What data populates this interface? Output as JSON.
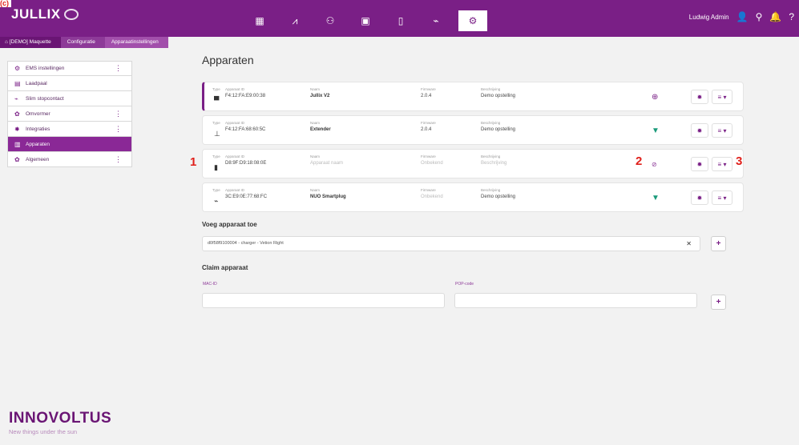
{
  "corner_badge": "(c)",
  "app": {
    "logo_text": "JULLIX"
  },
  "nav": {
    "icons": [
      "dashboard-icon",
      "chart-icon",
      "brain-icon",
      "battery-icon",
      "meter-icon",
      "plug-icon",
      "settings-icon"
    ],
    "glyphs": [
      "▦",
      "⩘",
      "⚇",
      "▣",
      "▯",
      "⌁",
      "⚙"
    ],
    "active": "settings-icon"
  },
  "user": {
    "name": "Ludwig Admin",
    "glyphs": {
      "person": "👤",
      "search": "⚲",
      "bell": "🔔",
      "help": "?"
    }
  },
  "breadcrumb": [
    "[DEMO] Maquette",
    "Configuratie",
    "Apparaatinstellingen"
  ],
  "sidebar": {
    "items": [
      {
        "label": "EMS instellingen",
        "glyph": "⚙",
        "kebab": "⋮"
      },
      {
        "label": "Laadpaal",
        "glyph": "▤",
        "kebab": ""
      },
      {
        "label": "Slim stopcontact",
        "glyph": "⌁",
        "kebab": ""
      },
      {
        "label": "Omvormer",
        "glyph": "✿",
        "kebab": "⋮"
      },
      {
        "label": "Integraties",
        "glyph": "✸",
        "kebab": "⋮"
      },
      {
        "label": "Apparaten",
        "glyph": "▥",
        "kebab": "",
        "active": true
      },
      {
        "label": "Algemeen",
        "glyph": "✿",
        "kebab": "⋮"
      }
    ]
  },
  "page_title": "Apparaten",
  "labels": {
    "type": "Type",
    "appid": "Apparaat ID",
    "name": "Naam",
    "firmware": "Firmware",
    "description": "Beschrijving"
  },
  "devices": [
    {
      "type_glyph": "▀",
      "mac": "F4:12:FA:E9:00:38",
      "name": "Jullix V2",
      "firmware": "2.0.4",
      "description": "Demo opstelling",
      "status_glyph": "⊕",
      "status_icon": "globe-icon",
      "selected": true
    },
    {
      "type_glyph": "⊥",
      "mac": "F4:12:FA:68:60:5C",
      "name": "Extender",
      "firmware": "2.0.4",
      "description": "Demo opstelling",
      "status_glyph": "▼",
      "status_icon": "wifi-icon"
    },
    {
      "type_glyph": "▮",
      "mac": "D8:9F:D9:18:08:0E",
      "name": "Apparaat naam",
      "firmware": "Onbekend",
      "description": "Beschrijving",
      "status_glyph": "⊘",
      "status_icon": "offline-icon",
      "muted": true
    },
    {
      "type_glyph": "⌁",
      "mac": "3C:E9:0E:77:68:FC",
      "name": "NUO Smartplug",
      "firmware": "Onbekend",
      "description": "Demo opstelling",
      "status_glyph": "▼",
      "status_icon": "wifi-icon"
    }
  ],
  "annotations": [
    "1",
    "2",
    "3"
  ],
  "add_device": {
    "title": "Voeg apparaat toe",
    "value": "d0f58f9100004 - charger - Vetion Right",
    "clear": "✕",
    "plus": "+"
  },
  "claim_device": {
    "title": "Claim apparaat",
    "mac_label": "MAC-ID",
    "pop_label": "POP-code",
    "plus": "+"
  },
  "brand": {
    "name": "INNOVOLTUS",
    "tagline": "New things under the sun"
  }
}
